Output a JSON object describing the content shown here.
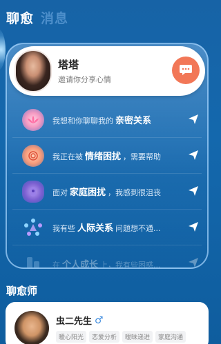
{
  "tabs": [
    {
      "label": "聊愈",
      "active": true
    },
    {
      "label": "消息",
      "active": false
    }
  ],
  "featured": {
    "name": "塔塔",
    "subtitle": "邀请你分享心情",
    "chat_icon": "chat-bubble-icon"
  },
  "topics": [
    {
      "prefix": "我想和你聊聊我的",
      "keyword": "亲密关系",
      "suffix": "",
      "icon": "lotus-icon"
    },
    {
      "prefix": "我正在被",
      "keyword": "情绪困扰",
      "suffix": "，需要帮助",
      "icon": "spiral-icon"
    },
    {
      "prefix": "面对",
      "keyword": "家庭困扰",
      "suffix": "，我感到很沮丧",
      "icon": "family-icon"
    },
    {
      "prefix": "我有些",
      "keyword": "人际关系",
      "suffix": "问题想不通...",
      "icon": "people-circle-icon"
    },
    {
      "prefix": "在",
      "keyword": "个人成长",
      "suffix": "上，我有些困惑...",
      "icon": "growth-icon"
    }
  ],
  "section": {
    "title": "聊愈师"
  },
  "counselor": {
    "name": "虫二先生",
    "gender_symbol": "♂",
    "tags": [
      "暖心阳光",
      "恋爱分析",
      "暧昧递进",
      "家庭沟通"
    ]
  },
  "colors": {
    "background": "#1468ad",
    "accent": "#f27757",
    "tab_inactive": "#4d8fcb"
  }
}
